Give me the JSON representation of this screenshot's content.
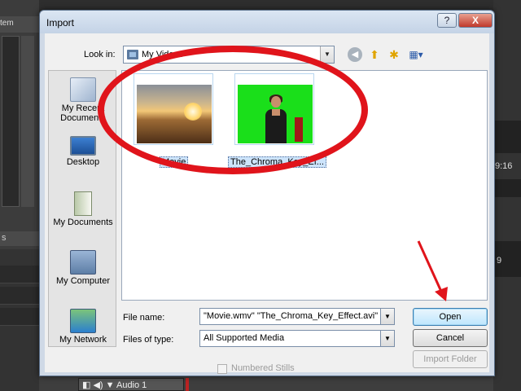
{
  "background_app": {
    "left_panel_title": "tem",
    "left_tab_label": "s",
    "right_timecode": "9:16",
    "right_label": "9",
    "audio_track_label": "Audio 1"
  },
  "dialog": {
    "title": "Import",
    "help_label": "?",
    "close_label": "X",
    "look_in_label": "Look in:",
    "look_in_value": "My Videos",
    "places": [
      {
        "label_line1": "My Recent",
        "label_line2": "Documents"
      },
      {
        "label_line1": "Desktop",
        "label_line2": ""
      },
      {
        "label_line1": "My Documents",
        "label_line2": ""
      },
      {
        "label_line1": "My Computer",
        "label_line2": ""
      },
      {
        "label_line1": "My Network",
        "label_line2": ""
      }
    ],
    "files": [
      {
        "name": "Movie"
      },
      {
        "name": "The_Chroma_Key_Ef..."
      }
    ],
    "file_name_label": "File name:",
    "file_name_value": "\"Movie.wmv\" \"The_Chroma_Key_Effect.avi\"",
    "files_of_type_label": "Files of type:",
    "files_of_type_value": "All Supported Media",
    "numbered_stills_label": "Numbered Stills",
    "open_label": "Open",
    "cancel_label": "Cancel",
    "import_folder_label": "Import Folder"
  },
  "colors": {
    "annotation_red": "#e0141b",
    "selection_blue": "#cde4fb",
    "chroma_green": "#1adf1a"
  }
}
